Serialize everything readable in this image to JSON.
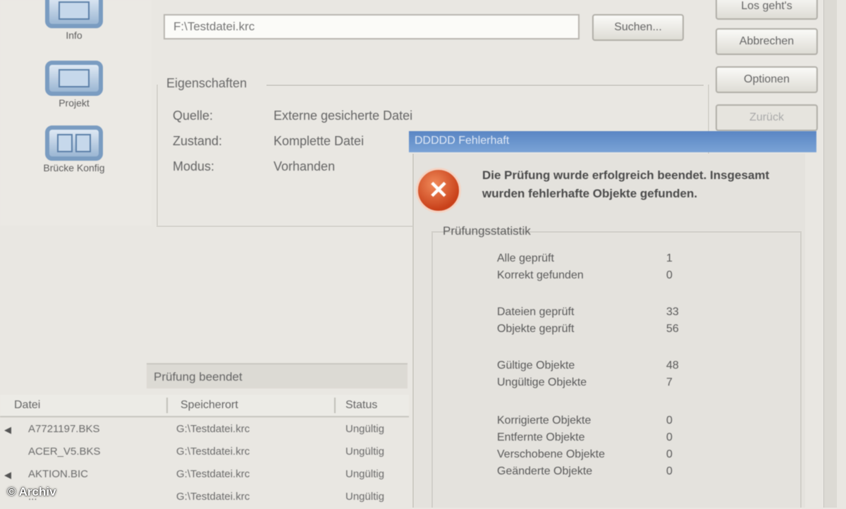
{
  "nav": {
    "items": [
      {
        "label": "Info",
        "icon": "monitor-icon"
      },
      {
        "label": "Projekt",
        "icon": "monitor-icon"
      },
      {
        "label": "Brücke Konfig",
        "icon": "dual-monitor-icon"
      }
    ]
  },
  "source": {
    "value": "F:\\Testdatei.krc",
    "browse_label": "Suchen..."
  },
  "side_buttons": [
    "Los geht's",
    "Abbrechen",
    "Optionen",
    "Zurück"
  ],
  "group": {
    "title": "Eigenschaften",
    "rows": [
      {
        "label": "Quelle:",
        "value": "Externe gesicherte Datei"
      },
      {
        "label": "Zustand:",
        "value": "Komplette Datei"
      },
      {
        "label": "Modus:",
        "value": "Vorhanden"
      }
    ],
    "highlight_value": "DDDDD Fehlerhaft"
  },
  "error": {
    "message": "Die Prüfung wurde erfolgreich beendet. Insgesamt wurden fehlerhafte Objekte gefunden.",
    "stats_title": "Prüfungsstatistik",
    "stats": [
      {
        "label": "Alle geprüft",
        "value": "1"
      },
      {
        "label": "Korrekt gefunden",
        "value": "0"
      },
      {
        "label": "Dateien geprüft",
        "value": "33"
      },
      {
        "label": "Objekte geprüft",
        "value": "56"
      },
      {
        "label": "Gültige Objekte",
        "value": "48"
      },
      {
        "label": "Ungültige Objekte",
        "value": "7"
      },
      {
        "label": "Korrigierte Objekte",
        "value": "0"
      },
      {
        "label": "Entfernte Objekte",
        "value": "0"
      },
      {
        "label": "Verschobene Objekte",
        "value": "0"
      },
      {
        "label": "Geänderte Objekte",
        "value": "0"
      }
    ]
  },
  "table": {
    "caption": "Prüfung beendet",
    "columns": [
      "Datei",
      "Speicherort",
      "Status"
    ],
    "rows": [
      {
        "name": "A7721197.BKS",
        "location": "G:\\Testdatei.krc",
        "status": "Ungültig"
      },
      {
        "name": "ACER_V5.BKS",
        "location": "G:\\Testdatei.krc",
        "status": "Ungültig"
      },
      {
        "name": "AKTION.BIC",
        "location": "G:\\Testdatei.krc",
        "status": "Ungültig"
      },
      {
        "name": "...",
        "location": "G:\\Testdatei.krc",
        "status": "Ungültig"
      }
    ]
  },
  "copyright": "© Archiv",
  "colors": {
    "selection": "#5a86c4",
    "error": "#c9411a",
    "panel": "#e9e7e2"
  }
}
